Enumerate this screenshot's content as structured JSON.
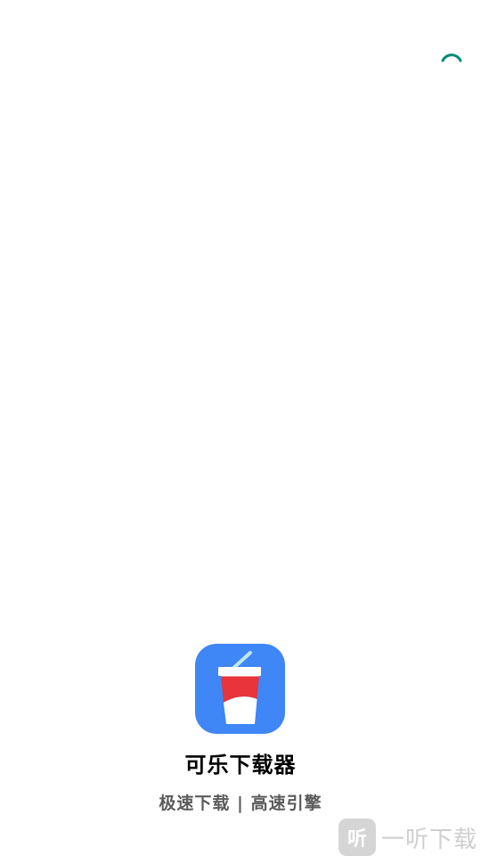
{
  "app": {
    "name": "可乐下载器",
    "slogan": "极速下载 | 高速引擎"
  },
  "spinner": {
    "color": "#00897b"
  },
  "logo": {
    "background": "#3f86f7"
  },
  "watermark": {
    "icon_char": "听",
    "text": "一听下载"
  }
}
